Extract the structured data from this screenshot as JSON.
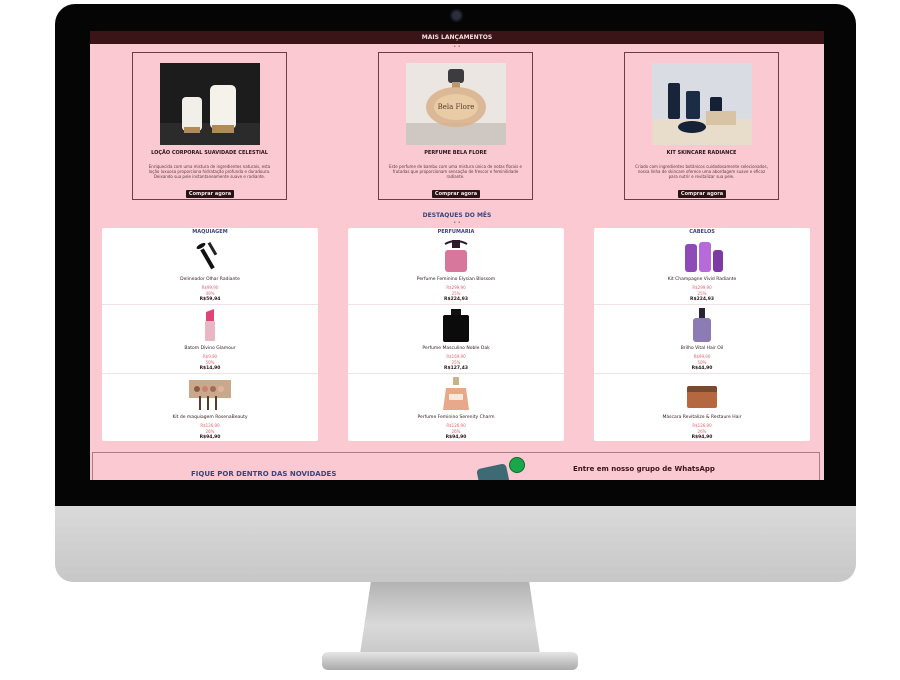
{
  "topbar": {
    "title": "MAIS LANÇAMENTOS"
  },
  "launches": [
    {
      "name": "LOÇÃO CORPORAL SUAVIDADE CELESTIAL",
      "desc": "Enriquecida com uma mistura de ingredientes naturais, esta loção luxuosa proporciona hidratação profunda e duradoura. Deixando sua pele instantaneamente suave e radiante.",
      "button": "Comprar agora",
      "icon": "lotion-bottles-icon"
    },
    {
      "name": "PERFUME BELA FLORE",
      "desc": "Este perfume de bambu com uma mistura única de notas florais e frutadas que proporcionam sensação de frescor e feminilidade radiante.",
      "button": "Comprar agora",
      "icon": "perfume-bottle-icon"
    },
    {
      "name": "KIT SKINCARE RADIANCE",
      "desc": "Criado com ingredientes botânicos cuidadosamente selecionados, nossa linha de skincare oferece uma abordagem suave e eficaz para nutrir e revitalizar sua pele.",
      "button": "Comprar agora",
      "icon": "skincare-kit-icon"
    }
  ],
  "highlights": {
    "title": "DESTAQUES DO MÊS",
    "columns": [
      {
        "category": "MAQUIAGEM",
        "products": [
          {
            "name": "Delineador Olhar Radiante",
            "old": "R$99,90",
            "off": "40%",
            "price": "R$59,94",
            "icon": "mascara-icon"
          },
          {
            "name": "Batom Divino Glamour",
            "old": "R$9,90",
            "off": "50%",
            "price": "R$14,90",
            "icon": "lipstick-icon"
          },
          {
            "name": "Kit de maquiagem RosenaBeauty",
            "old": "R$126,90",
            "off": "26%",
            "price": "R$94,90",
            "icon": "makeup-palette-icon"
          }
        ]
      },
      {
        "category": "PERFUMARIA",
        "products": [
          {
            "name": "Perfume Feminino Elysian Blossom",
            "old": "R$299,90",
            "off": "25%",
            "price": "R$224,93",
            "icon": "pink-perfume-icon"
          },
          {
            "name": "Perfume Masculino Noble Oak",
            "old": "R$169,90",
            "off": "25%",
            "price": "R$127,43",
            "icon": "black-perfume-icon"
          },
          {
            "name": "Perfume Feminino Serenity Charm",
            "old": "R$126,90",
            "off": "26%",
            "price": "R$94,90",
            "icon": "amber-perfume-icon"
          }
        ]
      },
      {
        "category": "CABELOS",
        "products": [
          {
            "name": "Kit Champagne Vivid Radiante",
            "old": "R$299,90",
            "off": "25%",
            "price": "R$224,93",
            "icon": "hair-kit-icon"
          },
          {
            "name": "Brilho Vital Hair Oil",
            "old": "R$99,90",
            "off": "50%",
            "price": "R$44,90",
            "icon": "hair-oil-icon"
          },
          {
            "name": "Máscara Revitalize & Restaure Hair",
            "old": "R$126,90",
            "off": "26%",
            "price": "R$94,90",
            "icon": "hair-mask-icon"
          }
        ]
      }
    ]
  },
  "newsletter": {
    "title": "FIQUE POR DENTRO DAS NOVIDADES",
    "whatsapp": "Entre em nosso grupo de WhatsApp",
    "icon": "whatsapp-icon"
  },
  "colors": {
    "screen_bg": "#fbc9d2",
    "topbar": "#3a1416",
    "accent_title": "#38467d",
    "discount": "#e0646f"
  }
}
